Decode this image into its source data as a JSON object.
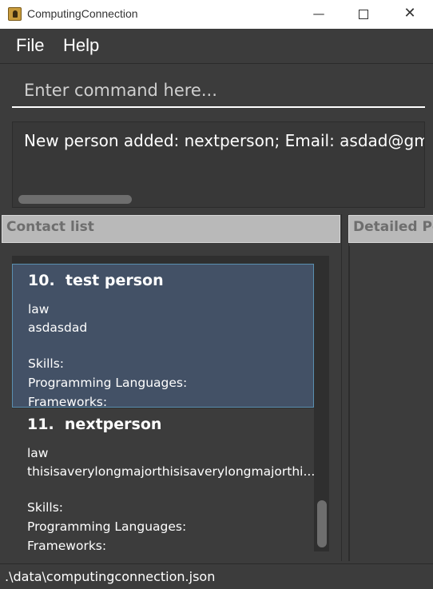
{
  "window": {
    "title": "ComputingConnection",
    "minimize_glyph": "—",
    "close_glyph": "✕"
  },
  "menu": {
    "items": [
      "File",
      "Help"
    ]
  },
  "command": {
    "placeholder": "Enter command here...",
    "value": ""
  },
  "result": {
    "text": "New person added: nextperson; Email: asdad@gma"
  },
  "panels": {
    "contact_list_label": "Contact list",
    "detail_label": "Detailed Pe"
  },
  "contacts": [
    {
      "index": "10.",
      "name": "test person",
      "lines": [
        "law",
        "asdasdad",
        "",
        "Skills:",
        "Programming Languages:",
        "Frameworks:"
      ],
      "selected": true
    },
    {
      "index": "11.",
      "name": "nextperson",
      "lines": [
        "law",
        "thisisaverylongmajorthisisaverylongmajorthi...",
        "",
        "Skills:",
        "Programming Languages:",
        "Frameworks:"
      ],
      "selected": false
    }
  ],
  "status": {
    "file_path": ".\\data\\computingconnection.json"
  },
  "colors": {
    "background": "#3c3c3c",
    "selected_card": "#435166",
    "header": "#b9b9b9"
  }
}
